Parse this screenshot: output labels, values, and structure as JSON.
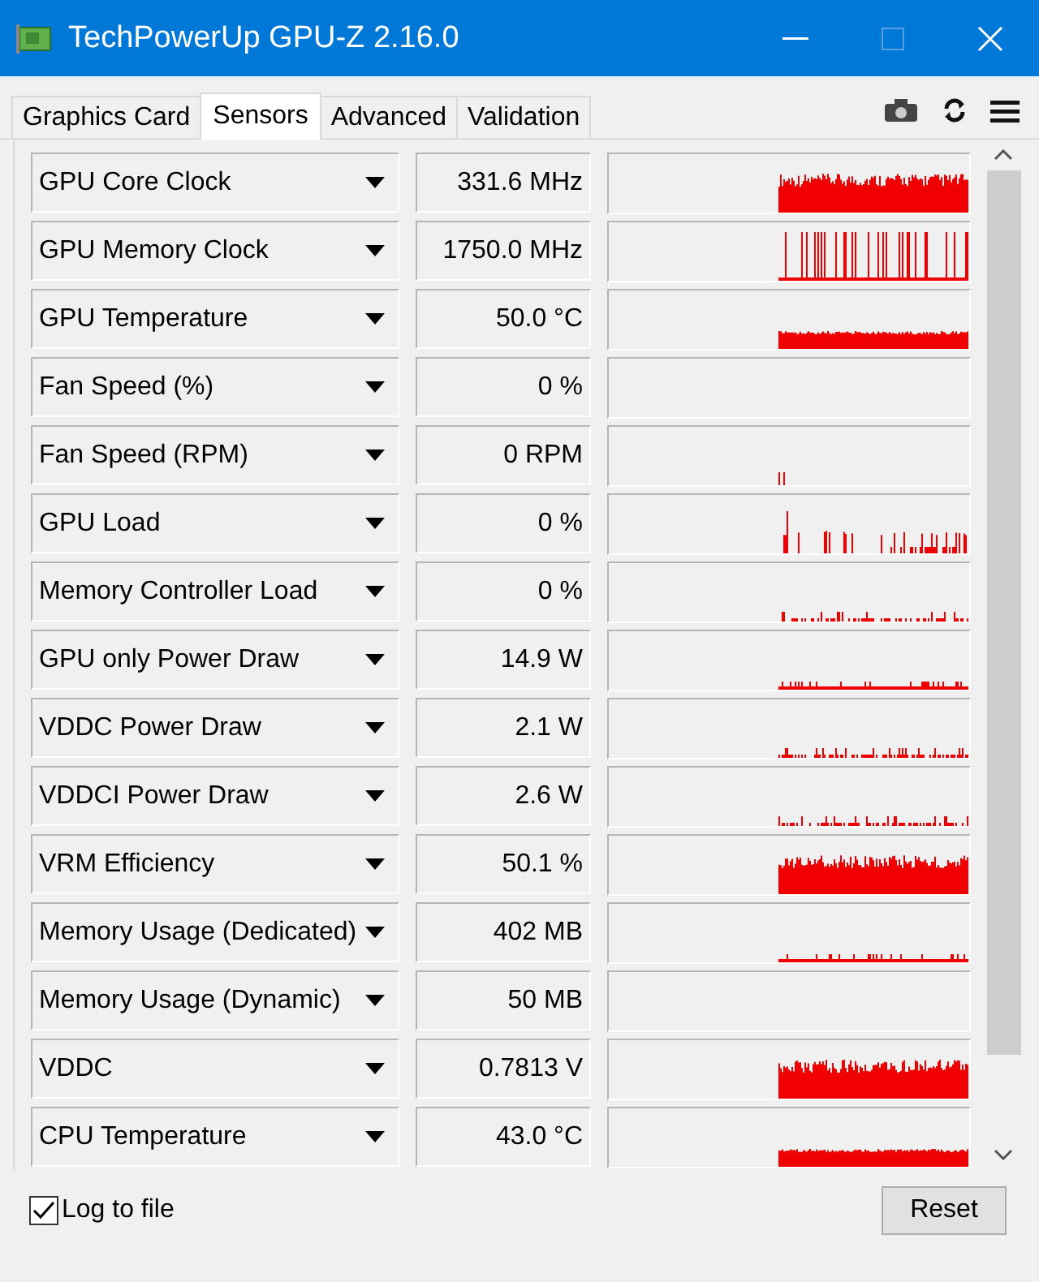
{
  "window": {
    "title": "TechPowerUp GPU-Z 2.16.0"
  },
  "tabs": [
    {
      "label": "Graphics Card",
      "selected": false
    },
    {
      "label": "Sensors",
      "selected": true
    },
    {
      "label": "Advanced",
      "selected": false
    },
    {
      "label": "Validation",
      "selected": false
    }
  ],
  "sensors": [
    {
      "name": "GPU Core Clock",
      "value": "331.6 MHz",
      "kind": "block"
    },
    {
      "name": "GPU Memory Clock",
      "value": "1750.0 MHz",
      "kind": "spikes"
    },
    {
      "name": "GPU Temperature",
      "value": "50.0 °C",
      "kind": "low"
    },
    {
      "name": "Fan Speed (%)",
      "value": "0 %",
      "kind": "none"
    },
    {
      "name": "Fan Speed (RPM)",
      "value": "0 RPM",
      "kind": "blip"
    },
    {
      "name": "GPU Load",
      "value": "0 %",
      "kind": "sparse"
    },
    {
      "name": "Memory Controller Load",
      "value": "0 %",
      "kind": "dots"
    },
    {
      "name": "GPU only Power Draw",
      "value": "14.9 W",
      "kind": "line"
    },
    {
      "name": "VDDC Power Draw",
      "value": "2.1 W",
      "kind": "dots"
    },
    {
      "name": "VDDCI Power Draw",
      "value": "2.6 W",
      "kind": "dots"
    },
    {
      "name": "VRM Efficiency",
      "value": "50.1 %",
      "kind": "block"
    },
    {
      "name": "Memory Usage (Dedicated)",
      "value": "402 MB",
      "kind": "line"
    },
    {
      "name": "Memory Usage (Dynamic)",
      "value": "50 MB",
      "kind": "none"
    },
    {
      "name": "VDDC",
      "value": "0.7813 V",
      "kind": "block"
    },
    {
      "name": "CPU Temperature",
      "value": "43.0 °C",
      "kind": "low"
    }
  ],
  "log_to_file": {
    "label": "Log to file",
    "checked": true
  },
  "reset_button": "Reset"
}
